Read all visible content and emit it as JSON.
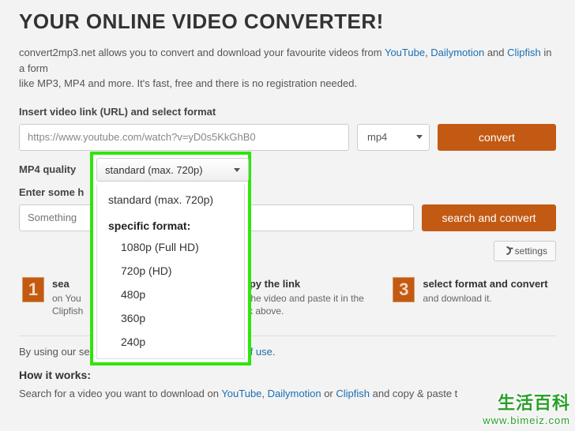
{
  "title": "YOUR ONLINE VIDEO CONVERTER!",
  "intro": {
    "pre": "convert2mp3.net allows you to convert and download your favourite videos from ",
    "links": [
      "YouTube",
      "Dailymotion",
      "Clipfish"
    ],
    "sep1": ", ",
    "sep2": " and ",
    "post": " in a form",
    "line2": "like MP3, MP4 and more. It's fast, free and there is no registration needed."
  },
  "url_section": {
    "label": "Insert video link (URL) and select format",
    "url_value": "https://www.youtube.com/watch?v=yD0s5KkGhB0",
    "format_value": "mp4",
    "button": "convert"
  },
  "quality": {
    "label": "MP4 quality",
    "selected": "standard (max. 720p)",
    "current_item": "standard (max. 720p)",
    "header": "specific format:",
    "options": [
      "1080p (Full HD)",
      "720p (HD)",
      "480p",
      "360p",
      "240p"
    ]
  },
  "search": {
    "label": "Enter some h",
    "placeholder": "Something",
    "button": "search and convert"
  },
  "settings_label": "settings",
  "steps": [
    {
      "num": "1",
      "title": "sea",
      "body1": "on You",
      "body2": "Clipfish"
    },
    {
      "num": "2",
      "title": "copy the link",
      "body1": "of the video and paste it in the",
      "body2": "box above."
    },
    {
      "num": "3",
      "title": "select format and convert",
      "body1": "and download it.",
      "body2": ""
    }
  ],
  "terms": {
    "pre": "By using our service you are accepting our ",
    "link": "terms of use",
    "post": "."
  },
  "how": {
    "title": "How it works:",
    "pre": "Search for a video you want to download on ",
    "links": [
      "YouTube",
      "Dailymotion",
      "Clipfish"
    ],
    "sep1": ", ",
    "sep2": " or ",
    "post": " and copy & paste t"
  },
  "watermark": {
    "line1": "生活百科",
    "line2": "www.bimeiz.com"
  }
}
